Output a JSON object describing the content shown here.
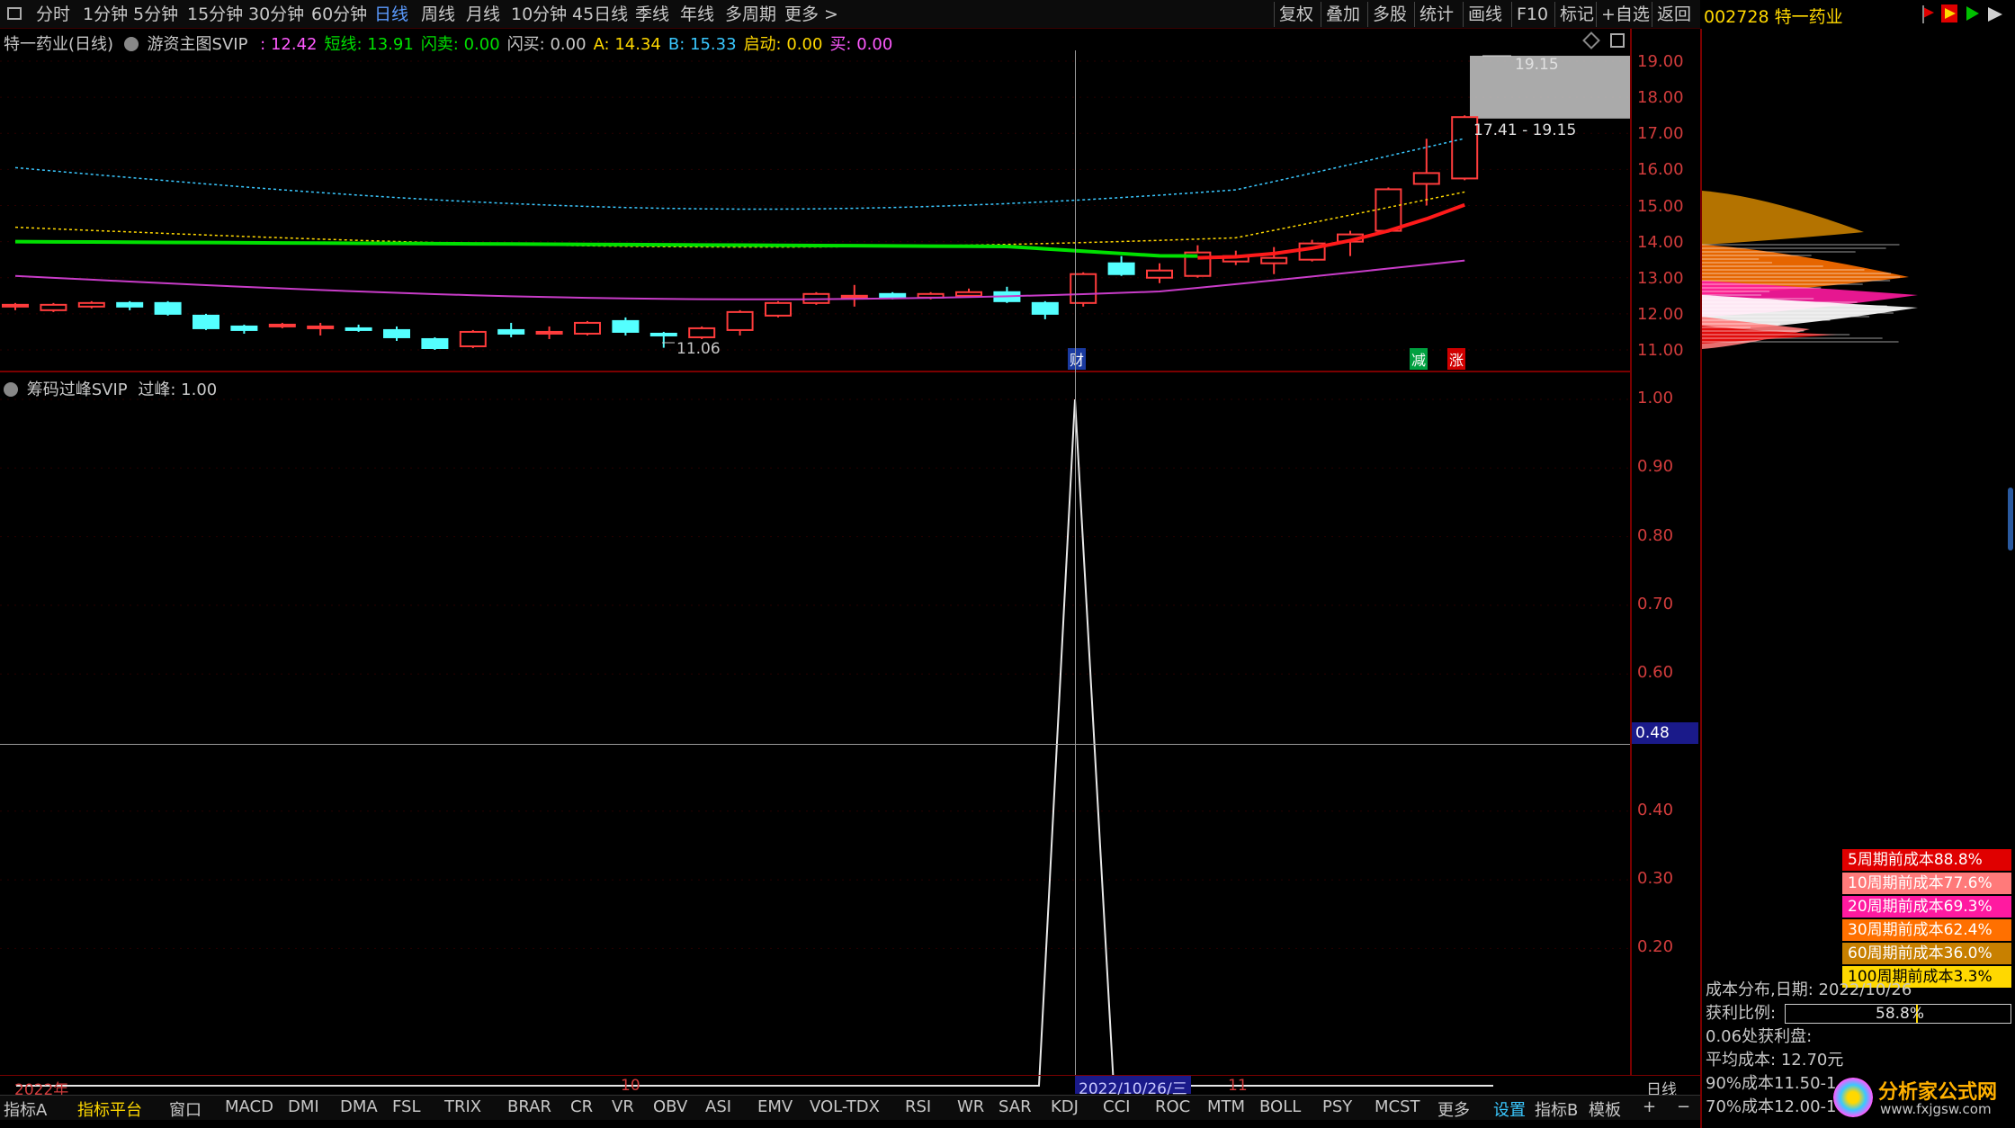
{
  "toolbar": {
    "periods": [
      "分时",
      "1分钟",
      "5分钟",
      "15分钟",
      "30分钟",
      "60分钟",
      "日线",
      "周线",
      "月线",
      "10分钟",
      "45日线",
      "季线",
      "年线",
      "多周期",
      "更多 >"
    ],
    "active_period": "日线",
    "tools": [
      "复权",
      "叠加",
      "多股",
      "统计",
      "画线",
      "F10",
      "标记",
      "+自选",
      "返回"
    ]
  },
  "stock": {
    "code_name": "002728 特一药业"
  },
  "main_chart": {
    "title": "特一药业(日线)",
    "indicator": "游资主图SVIP",
    "fields": [
      {
        "label": "",
        "value": ": 12.42",
        "color": "#ff5aff"
      },
      {
        "label": "短线:",
        "value": " 13.91",
        "color": "#00e000"
      },
      {
        "label": "闪卖:",
        "value": " 0.00",
        "color": "#00e000"
      },
      {
        "label": "闪买:",
        "value": " 0.00",
        "color": "#c8c8c8"
      },
      {
        "label": "A:",
        "value": " 14.34",
        "color": "#ffd800"
      },
      {
        "label": "B:",
        "value": " 15.33",
        "color": "#3ac8ff"
      },
      {
        "label": "启动:",
        "value": " 0.00",
        "color": "#ffd800"
      },
      {
        "label": "买:",
        "value": " 0.00",
        "color": "#ff5aff"
      }
    ],
    "high_label": "19.15",
    "low_label": "11.06",
    "range_label": "17.41 - 19.15",
    "markers": {
      "cai": "财",
      "jian": "减",
      "zhang": "涨"
    },
    "price_axis": [
      "19.00",
      "18.00",
      "17.00",
      "16.00",
      "15.00",
      "14.00",
      "13.00",
      "12.00",
      "11.00"
    ]
  },
  "candles": [
    {
      "o": 12.2,
      "c": 12.25,
      "h": 12.3,
      "l": 12.1
    },
    {
      "o": 12.1,
      "c": 12.25,
      "h": 12.3,
      "l": 12.05
    },
    {
      "o": 12.2,
      "c": 12.3,
      "h": 12.35,
      "l": 12.15
    },
    {
      "o": 12.3,
      "c": 12.2,
      "h": 12.35,
      "l": 12.1
    },
    {
      "o": 12.3,
      "c": 12.0,
      "h": 12.35,
      "l": 11.95
    },
    {
      "o": 11.95,
      "c": 11.6,
      "h": 12.0,
      "l": 11.55
    },
    {
      "o": 11.65,
      "c": 11.55,
      "h": 11.7,
      "l": 11.45
    },
    {
      "o": 11.65,
      "c": 11.7,
      "h": 11.75,
      "l": 11.6
    },
    {
      "o": 11.65,
      "c": 11.65,
      "h": 11.75,
      "l": 11.4
    },
    {
      "o": 11.6,
      "c": 11.55,
      "h": 11.7,
      "l": 11.5
    },
    {
      "o": 11.55,
      "c": 11.35,
      "h": 11.65,
      "l": 11.25
    },
    {
      "o": 11.3,
      "c": 11.05,
      "h": 11.35,
      "l": 11.0
    },
    {
      "o": 11.1,
      "c": 11.5,
      "h": 11.55,
      "l": 11.05
    },
    {
      "o": 11.55,
      "c": 11.45,
      "h": 11.75,
      "l": 11.35
    },
    {
      "o": 11.5,
      "c": 11.5,
      "h": 11.65,
      "l": 11.3
    },
    {
      "o": 11.45,
      "c": 11.75,
      "h": 11.8,
      "l": 11.4
    },
    {
      "o": 11.8,
      "c": 11.5,
      "h": 11.9,
      "l": 11.4
    },
    {
      "o": 11.45,
      "c": 11.4,
      "h": 11.5,
      "l": 11.06
    },
    {
      "o": 11.35,
      "c": 11.6,
      "h": 11.65,
      "l": 11.3
    },
    {
      "o": 11.55,
      "c": 12.05,
      "h": 12.1,
      "l": 11.4
    },
    {
      "o": 11.95,
      "c": 12.3,
      "h": 12.35,
      "l": 11.9
    },
    {
      "o": 12.3,
      "c": 12.55,
      "h": 12.6,
      "l": 12.25
    },
    {
      "o": 12.5,
      "c": 12.5,
      "h": 12.8,
      "l": 12.2
    },
    {
      "o": 12.55,
      "c": 12.45,
      "h": 12.6,
      "l": 12.4
    },
    {
      "o": 12.45,
      "c": 12.55,
      "h": 12.6,
      "l": 12.4
    },
    {
      "o": 12.5,
      "c": 12.6,
      "h": 12.7,
      "l": 12.45
    },
    {
      "o": 12.6,
      "c": 12.35,
      "h": 12.75,
      "l": 12.3
    },
    {
      "o": 12.3,
      "c": 12.0,
      "h": 12.35,
      "l": 11.85
    },
    {
      "o": 12.3,
      "c": 13.1,
      "h": 13.15,
      "l": 12.2
    },
    {
      "o": 13.4,
      "c": 13.1,
      "h": 13.6,
      "l": 13.05
    },
    {
      "o": 13.0,
      "c": 13.2,
      "h": 13.4,
      "l": 12.85
    },
    {
      "o": 13.05,
      "c": 13.7,
      "h": 13.9,
      "l": 13.0
    },
    {
      "o": 13.45,
      "c": 13.6,
      "h": 13.75,
      "l": 13.35
    },
    {
      "o": 13.4,
      "c": 13.55,
      "h": 13.85,
      "l": 13.1
    },
    {
      "o": 13.5,
      "c": 13.95,
      "h": 14.05,
      "l": 13.45
    },
    {
      "o": 14.0,
      "c": 14.2,
      "h": 14.3,
      "l": 13.6
    },
    {
      "o": 14.3,
      "c": 15.45,
      "h": 15.5,
      "l": 14.25
    },
    {
      "o": 15.6,
      "c": 15.9,
      "h": 16.85,
      "l": 15.0
    },
    {
      "o": 15.75,
      "c": 17.45,
      "h": 17.5,
      "l": 15.7
    }
  ],
  "sub_chart": {
    "indicator": "筹码过峰SVIP",
    "field_label": "过峰:",
    "field_value": " 1.00",
    "axis": [
      "1.00",
      "0.90",
      "0.80",
      "0.70",
      "0.60",
      "0.40",
      "0.30",
      "0.20"
    ],
    "cursor_value": "0.48"
  },
  "date_axis": {
    "labels": [
      "2022年",
      "10",
      "11"
    ],
    "cursor_date": "2022/10/26/三",
    "period": "日线"
  },
  "bottom_tabs": {
    "left": [
      "指标A",
      "指标平台",
      "窗口",
      "MACD",
      "DMI",
      "DMA",
      "FSL",
      "TRIX",
      "BRAR",
      "CR",
      "VR",
      "OBV",
      "ASI",
      "EMV",
      "VOL-TDX",
      "RSI",
      "WR",
      "SAR",
      "KDJ",
      "CCI",
      "ROC",
      "MTM",
      "BOLL",
      "PSY",
      "MCST",
      "更多",
      "设置"
    ],
    "right": [
      "指标B",
      "模板",
      "+",
      "−"
    ]
  },
  "cost_panel": {
    "legend": [
      {
        "label": "5周期前成本88.8%",
        "color": "#e00000"
      },
      {
        "label": "10周期前成本77.6%",
        "color": "#ff7a7a"
      },
      {
        "label": "20周期前成本69.3%",
        "color": "#ff1aa0"
      },
      {
        "label": "30周期前成本62.4%",
        "color": "#ff7000"
      },
      {
        "label": "60周期前成本36.0%",
        "color": "#c88000"
      },
      {
        "label": "100周期前成本3.3%",
        "color": "#ffd800"
      }
    ],
    "date_label": "成本分布,日期:",
    "date_value": "2022/10/26",
    "profit_label": "获利比例:",
    "profit_value": "58.8%",
    "profit_fraction": 0.588,
    "profit_at": "0.06处获利盘:",
    "avg_cost_label": "平均成本:",
    "avg_cost_value": "12.70元",
    "cost90": "90%成本11.50-1",
    "cost70": "70%成本12.00-1"
  },
  "watermark": {
    "title": "分析家公式网",
    "url": "www.fxjgsw.com"
  }
}
